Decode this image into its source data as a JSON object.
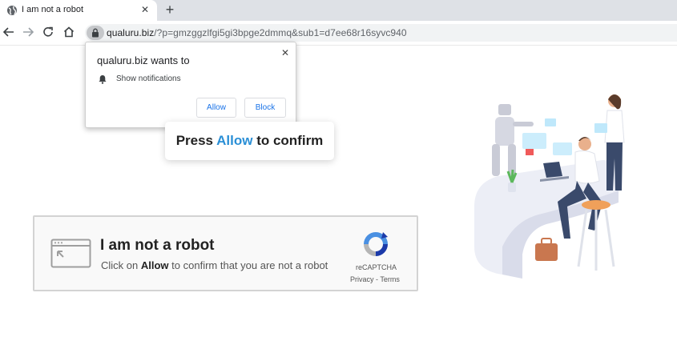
{
  "browser": {
    "tab_title": "I am not a robot",
    "tab_close": "✕",
    "new_tab": "+",
    "url_host": "qualuru.biz",
    "url_path": "/?p=gmzggzlfgi5gi3bpge2dmmq&sub1=d7ee68r16syvc940",
    "icons": [
      "globe-icon",
      "close-icon",
      "plus-icon",
      "back-icon",
      "forward-icon",
      "reload-icon",
      "home-icon",
      "lock-icon"
    ]
  },
  "permission_popup": {
    "title": "qualuru.biz wants to",
    "close": "✕",
    "description": "Show notifications",
    "allow_label": "Allow",
    "block_label": "Block",
    "icons": [
      "bell-icon"
    ]
  },
  "press_banner": {
    "before": "Press",
    "highlight": "Allow",
    "after": "to confirm",
    "highlight_color": "#2a8fd6"
  },
  "captcha": {
    "title": "I am not a robot",
    "sub_before": "Click on",
    "sub_bold": "Allow",
    "sub_after": "to confirm that you are not a robot",
    "brand": "reCAPTCHA",
    "links": "Privacy - Terms",
    "icons": [
      "window-icon",
      "recaptcha-logo-icon"
    ]
  },
  "colors": {
    "tabstrip": "#dee1e6",
    "link_blue": "#1a73e8",
    "accent_blue": "#2a8fd6"
  }
}
